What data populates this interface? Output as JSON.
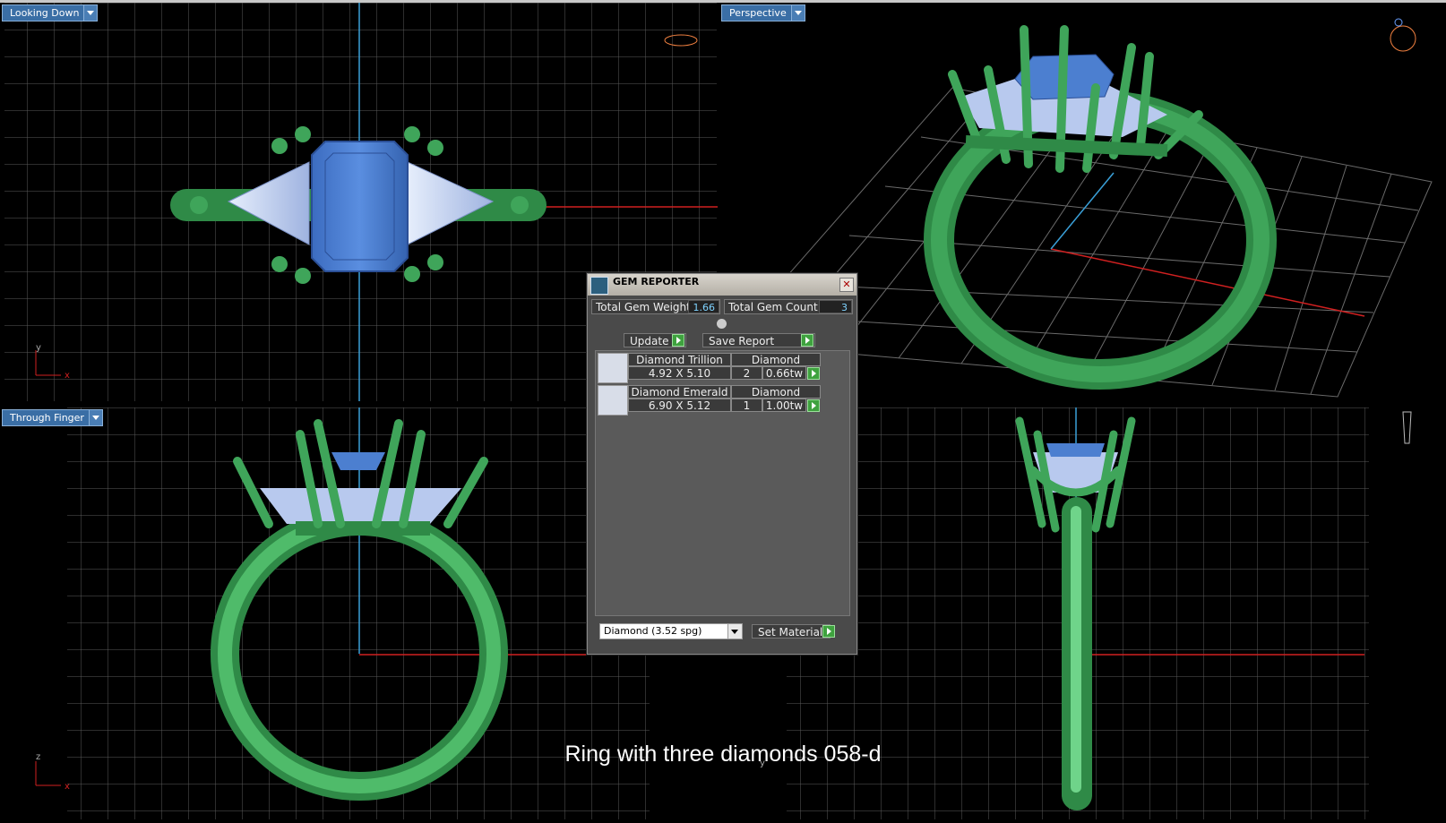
{
  "viewports": {
    "top_left": {
      "label": "Looking Down",
      "axis_v": "y",
      "axis_h": "x"
    },
    "top_right": {
      "label": "Perspective"
    },
    "bottom_left": {
      "label": "Through Finger",
      "axis_v": "z",
      "axis_h": "x"
    },
    "bottom_right": {
      "axis_v": "y"
    }
  },
  "gem_reporter": {
    "title": "GEM REPORTER",
    "close_glyph": "✕",
    "total_weight_label": "Total Gem Weight",
    "total_weight_value": "1.66",
    "total_count_label": "Total Gem Count",
    "total_count_value": "3",
    "update_label": "Update",
    "save_report_label": "Save Report",
    "rows": [
      {
        "name": "Diamond Trillion",
        "material": "Diamond",
        "size": "4.92 X 5.10",
        "qty": "2",
        "weight": "0.66tw"
      },
      {
        "name": "Diamond Emerald",
        "material": "Diamond",
        "size": "6.90 X 5.12",
        "qty": "1",
        "weight": "1.00tw"
      }
    ],
    "material_select": "Diamond    (3.52 spg)",
    "set_material_label": "Set Material"
  },
  "caption": "Ring with three diamonds  058-d",
  "colors": {
    "metal": "#3fa55a",
    "gem_blue": "#4c7fd0",
    "gem_light": "#b8c9ee",
    "grid": "#666666",
    "axis_red": "#d02020",
    "axis_blue": "#3aa0d8",
    "label_bg": "#3a6ea5"
  }
}
